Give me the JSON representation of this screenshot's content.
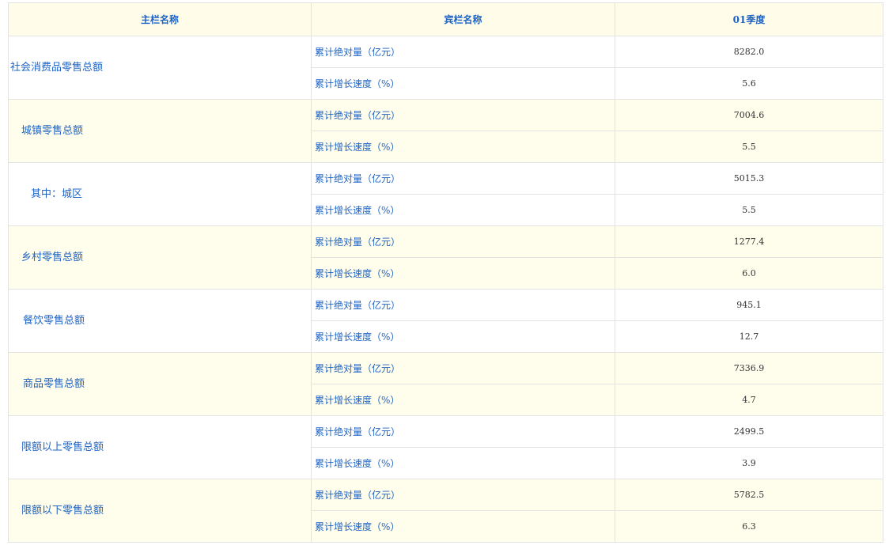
{
  "table": {
    "headers": {
      "main": "主栏名称",
      "guest": "宾栏名称",
      "period": "01季度"
    },
    "groups": [
      {
        "name": "社会消费品零售总额",
        "indent": 0,
        "rows": [
          {
            "metric": "累计绝对量（亿元）",
            "value": "8282.0"
          },
          {
            "metric": "累计增长速度（%）",
            "value": "5.6"
          }
        ]
      },
      {
        "name": "城镇零售总额",
        "indent": 1,
        "rows": [
          {
            "metric": "累计绝对量（亿元）",
            "value": "7004.6"
          },
          {
            "metric": "累计增长速度（%）",
            "value": "5.5"
          }
        ]
      },
      {
        "name": "其中：城区",
        "indent": 2,
        "rows": [
          {
            "metric": "累计绝对量（亿元）",
            "value": "5015.3"
          },
          {
            "metric": "累计增长速度（%）",
            "value": "5.5"
          }
        ]
      },
      {
        "name": "乡村零售总额",
        "indent": 1,
        "rows": [
          {
            "metric": "累计绝对量（亿元）",
            "value": "1277.4"
          },
          {
            "metric": "累计增长速度（%）",
            "value": "6.0"
          }
        ]
      },
      {
        "name": "餐饮零售总额",
        "indent": 3,
        "rows": [
          {
            "metric": "累计绝对量（亿元）",
            "value": "945.1"
          },
          {
            "metric": "累计增长速度（%）",
            "value": "12.7"
          }
        ]
      },
      {
        "name": "商品零售总额",
        "indent": 3,
        "rows": [
          {
            "metric": "累计绝对量（亿元）",
            "value": "7336.9"
          },
          {
            "metric": "累计增长速度（%）",
            "value": "4.7"
          }
        ]
      },
      {
        "name": "限额以上零售总额",
        "indent": 1,
        "rows": [
          {
            "metric": "累计绝对量（亿元）",
            "value": "2499.5"
          },
          {
            "metric": "累计增长速度（%）",
            "value": "3.9"
          }
        ]
      },
      {
        "name": "限额以下零售总额",
        "indent": 1,
        "rows": [
          {
            "metric": "累计绝对量（亿元）",
            "value": "5782.5"
          },
          {
            "metric": "累计增长速度（%）",
            "value": "6.3"
          }
        ]
      }
    ]
  },
  "colors": {
    "link_blue": "#1e63c4",
    "header_bg": "#fffdea",
    "band_bg": "#fffdeb",
    "border": "#e3e3e3"
  }
}
